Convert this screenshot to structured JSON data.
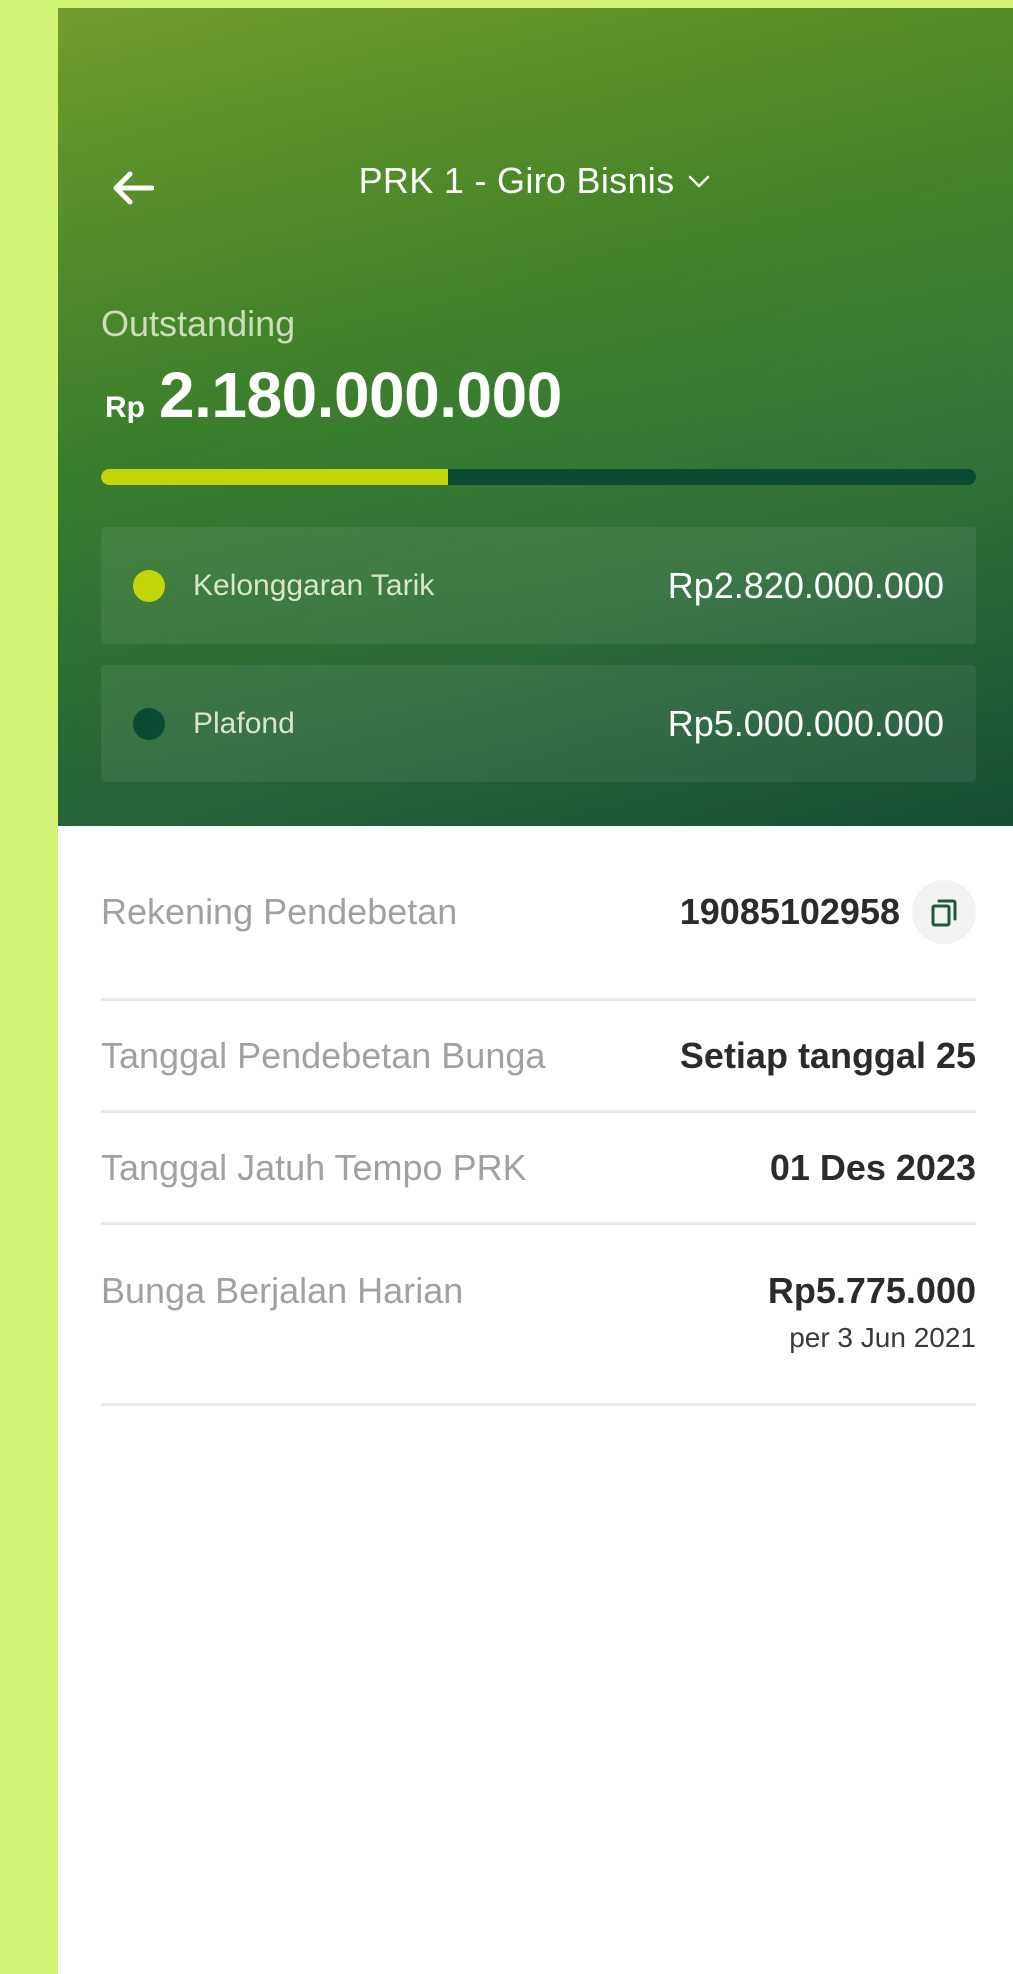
{
  "header": {
    "title": "PRK 1 - Giro Bisnis",
    "outstanding_label": "Outstanding",
    "currency": "Rp",
    "amount": "2.180.000.000",
    "progress_fraction": 0.396,
    "colors": {
      "progress_fill": "#c3d60a",
      "progress_track": "#0b4a33",
      "gradient_top": "#6a9521",
      "gradient_bottom": "#154e34"
    },
    "cards": [
      {
        "label": "Kelonggaran Tarik",
        "value": "Rp2.820.000.000",
        "dot_color": "#c3d60a"
      },
      {
        "label": "Plafond",
        "value": "Rp5.000.000.000",
        "dot_color": "#0b4a33"
      }
    ]
  },
  "details": {
    "rows": [
      {
        "label": "Rekening Pendebetan",
        "value": "19085102958",
        "icon": "copy-icon"
      },
      {
        "label": "Tanggal Pendebetan Bunga",
        "value": "Setiap tanggal 25"
      },
      {
        "label": "Tanggal Jatuh Tempo PRK",
        "value": "01 Des 2023"
      },
      {
        "label": "Bunga Berjalan Harian",
        "value": "Rp5.775.000",
        "sub": "per 3 Jun 2021"
      }
    ]
  },
  "icons": {
    "back": "arrow-left-icon",
    "dropdown": "chevron-down-icon"
  }
}
